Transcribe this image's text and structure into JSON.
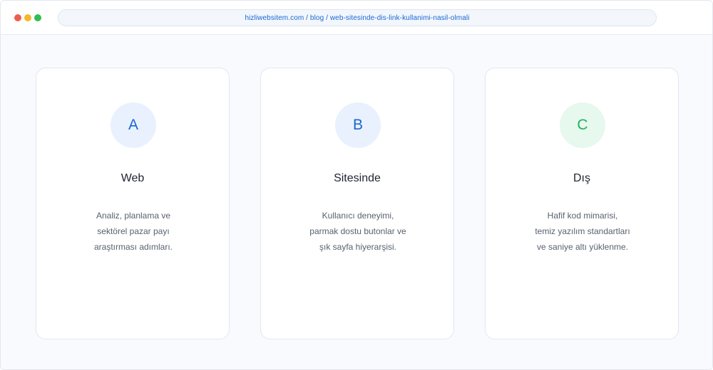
{
  "browser": {
    "url": "hizliwebsitem.com / blog / web-sitesinde-dis-link-kullanimi-nasil-olmali",
    "dots": [
      "#ee5d50",
      "#f4b62c",
      "#2fbf4f"
    ]
  },
  "cards": [
    {
      "letter": "A",
      "title": "Web",
      "lines": [
        "Analiz, planlama ve",
        "sektörel pazar payı",
        "araştırması adımları."
      ],
      "badge_bg": "#e8f1fd",
      "badge_color": "#1a67d2"
    },
    {
      "letter": "B",
      "title": "Sitesinde",
      "lines": [
        "Kullanıcı deneyimi,",
        "parmak dostu butonlar ve",
        "şık sayfa hiyerarşisi."
      ],
      "badge_bg": "#e8f1fd",
      "badge_color": "#1a67d2"
    },
    {
      "letter": "C",
      "title": "Dış",
      "lines": [
        "Hafif kod mimarisi,",
        "temiz yazılım standartları",
        "ve saniye altı yüklenme."
      ],
      "badge_bg": "#e7f8ee",
      "badge_color": "#1fb35e"
    }
  ]
}
